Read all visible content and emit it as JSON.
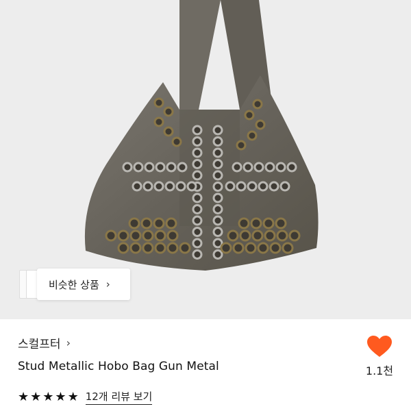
{
  "product": {
    "brand": "스컬프터",
    "title": "Stud Metallic Hobo Bag Gun Metal",
    "rating_stars": 5,
    "review_link": "12개 리뷰 보기",
    "like_count": "1.1천"
  },
  "hero": {
    "similar_button_label": "비슷한 상품",
    "background_color": "#ededed"
  },
  "icons": {
    "chevron": "›",
    "star": "★",
    "heart": "heart-icon"
  },
  "colors": {
    "heart": "#ff5a1f",
    "bag": "#6e6a62",
    "silver_eyelet": "#b9b7b2",
    "brass_eyelet": "#8a7748"
  }
}
